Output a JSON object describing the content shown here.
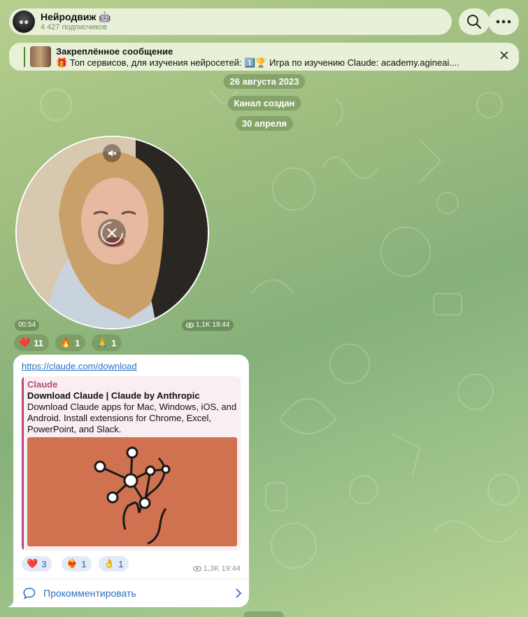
{
  "channel": {
    "title": "Нейродвиж 🤖",
    "subscribers": "4 427 подписчиков"
  },
  "pinned": {
    "title": "Закреплённое сообщение",
    "text": "🎁 Топ сервисов, для изучения нейросетей:  1️⃣🏆 Игра по изучению Claude: academy.agineai...."
  },
  "dates": [
    "26 августа 2023",
    "Канал создан",
    "30 апреля"
  ],
  "video_message": {
    "duration": "00:54",
    "views_time": "1,1K 19:44",
    "reactions": [
      {
        "emoji": "❤️",
        "count": "11"
      },
      {
        "emoji": "🔥",
        "count": "1"
      },
      {
        "emoji": "🙏",
        "count": "1"
      }
    ]
  },
  "link_message": {
    "url": "https://claude.com/download",
    "preview": {
      "site": "Claude",
      "title": "Download Claude | Claude by Anthropic",
      "description": "Download Claude apps for Mac, Windows, iOS, and Android. Install extensions for Chrome, Excel, PowerPoint, and Slack."
    },
    "reactions": [
      {
        "emoji": "❤️",
        "count": "3"
      },
      {
        "emoji": "❤️‍🔥",
        "count": "1"
      },
      {
        "emoji": "👌",
        "count": "1"
      }
    ],
    "views_time": "1,3K 19:44",
    "comment_label": "Прокомментировать"
  },
  "colors": {
    "accent": "#2a6ec0",
    "preview_accent": "#b8497a",
    "preview_image_bg": "#d0714f",
    "header_bg": "#e8f0d8"
  },
  "icons": [
    "search-icon",
    "more-icon",
    "close-icon",
    "mute-icon",
    "eye-icon",
    "comment-icon",
    "chevron-right-icon"
  ]
}
